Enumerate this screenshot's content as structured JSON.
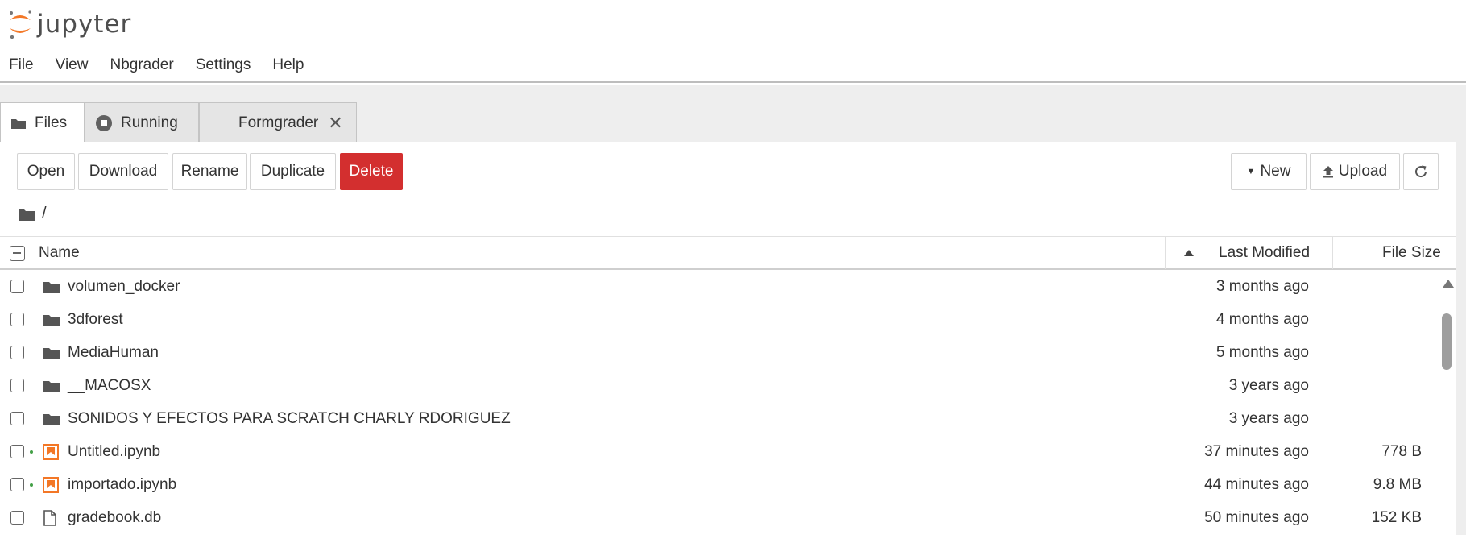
{
  "app": {
    "name": "jupyter"
  },
  "menu": [
    "File",
    "View",
    "Nbgrader",
    "Settings",
    "Help"
  ],
  "tabs": [
    {
      "label": "Files",
      "icon": "folder-icon"
    },
    {
      "label": "Running",
      "icon": "stop-circle-icon"
    },
    {
      "label": "Formgrader",
      "icon": "close-icon"
    }
  ],
  "toolbar": {
    "open": "Open",
    "download": "Download",
    "rename": "Rename",
    "duplicate": "Duplicate",
    "delete": "Delete",
    "new": "New",
    "upload": "Upload"
  },
  "breadcrumb": {
    "path": "/"
  },
  "columns": {
    "name": "Name",
    "modified": "Last Modified",
    "size": "File Size"
  },
  "files": [
    {
      "name": "volumen_docker",
      "type": "folder",
      "modified": "3 months ago",
      "size": "",
      "running": false
    },
    {
      "name": "3dforest",
      "type": "folder",
      "modified": "4 months ago",
      "size": "",
      "running": false
    },
    {
      "name": "MediaHuman",
      "type": "folder",
      "modified": "5 months ago",
      "size": "",
      "running": false
    },
    {
      "name": "__MACOSX",
      "type": "folder",
      "modified": "3 years ago",
      "size": "",
      "running": false
    },
    {
      "name": "SONIDOS Y EFECTOS PARA SCRATCH CHARLY RDORIGUEZ",
      "type": "folder",
      "modified": "3 years ago",
      "size": "",
      "running": false
    },
    {
      "name": "Untitled.ipynb",
      "type": "notebook",
      "modified": "37 minutes ago",
      "size": "778 B",
      "running": true
    },
    {
      "name": "importado.ipynb",
      "type": "notebook",
      "modified": "44 minutes ago",
      "size": "9.8 MB",
      "running": true
    },
    {
      "name": "gradebook.db",
      "type": "file",
      "modified": "50 minutes ago",
      "size": "152 KB",
      "running": false
    }
  ],
  "colors": {
    "accent": "#f37726",
    "danger": "#d32f2f",
    "running": "#43a047"
  }
}
